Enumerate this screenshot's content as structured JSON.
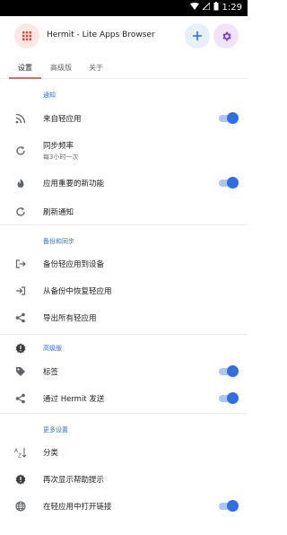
{
  "status_bar": {
    "time": "1:29"
  },
  "app_bar": {
    "title": "Hermit - Lite Apps Browser"
  },
  "tabs": [
    {
      "label": "设置",
      "active": true
    },
    {
      "label": "高级版",
      "active": false
    },
    {
      "label": "关于",
      "active": false
    }
  ],
  "sections": [
    {
      "header": "通知",
      "items": [
        {
          "label": "来自轻应用",
          "icon": "rss-icon",
          "toggle": true
        },
        {
          "label": "同步频率",
          "sublabel": "每3小时一次",
          "icon": "sync-icon"
        },
        {
          "label": "应用重要的新功能",
          "icon": "flame-icon",
          "toggle": true
        },
        {
          "label": "刷新通知",
          "icon": "refresh-icon"
        }
      ]
    },
    {
      "header": "备份和同步",
      "items": [
        {
          "label": "备份轻应用到设备",
          "icon": "export-icon"
        },
        {
          "label": "从备份中恢复轻应用",
          "icon": "import-icon"
        },
        {
          "label": "导出所有轻应用",
          "icon": "share-icon"
        }
      ]
    },
    {
      "header": "高级版",
      "items": [
        {
          "label": "标签",
          "icon": "tag-icon",
          "toggle": true
        },
        {
          "label": "通过 Hermit 发送",
          "icon": "share-icon",
          "toggle": true
        }
      ]
    },
    {
      "header": "更多设置",
      "items": [
        {
          "label": "分类",
          "icon": "sort-az-icon"
        },
        {
          "label": "再次显示帮助提示",
          "icon": "help-icon"
        },
        {
          "label": "在轻应用中打开链接",
          "icon": "globe-icon",
          "toggle": true
        }
      ]
    }
  ],
  "colors": {
    "accent": "#2f6fe0",
    "tab_indicator": "#e06c5d",
    "section_header": "#3a6fd8"
  }
}
